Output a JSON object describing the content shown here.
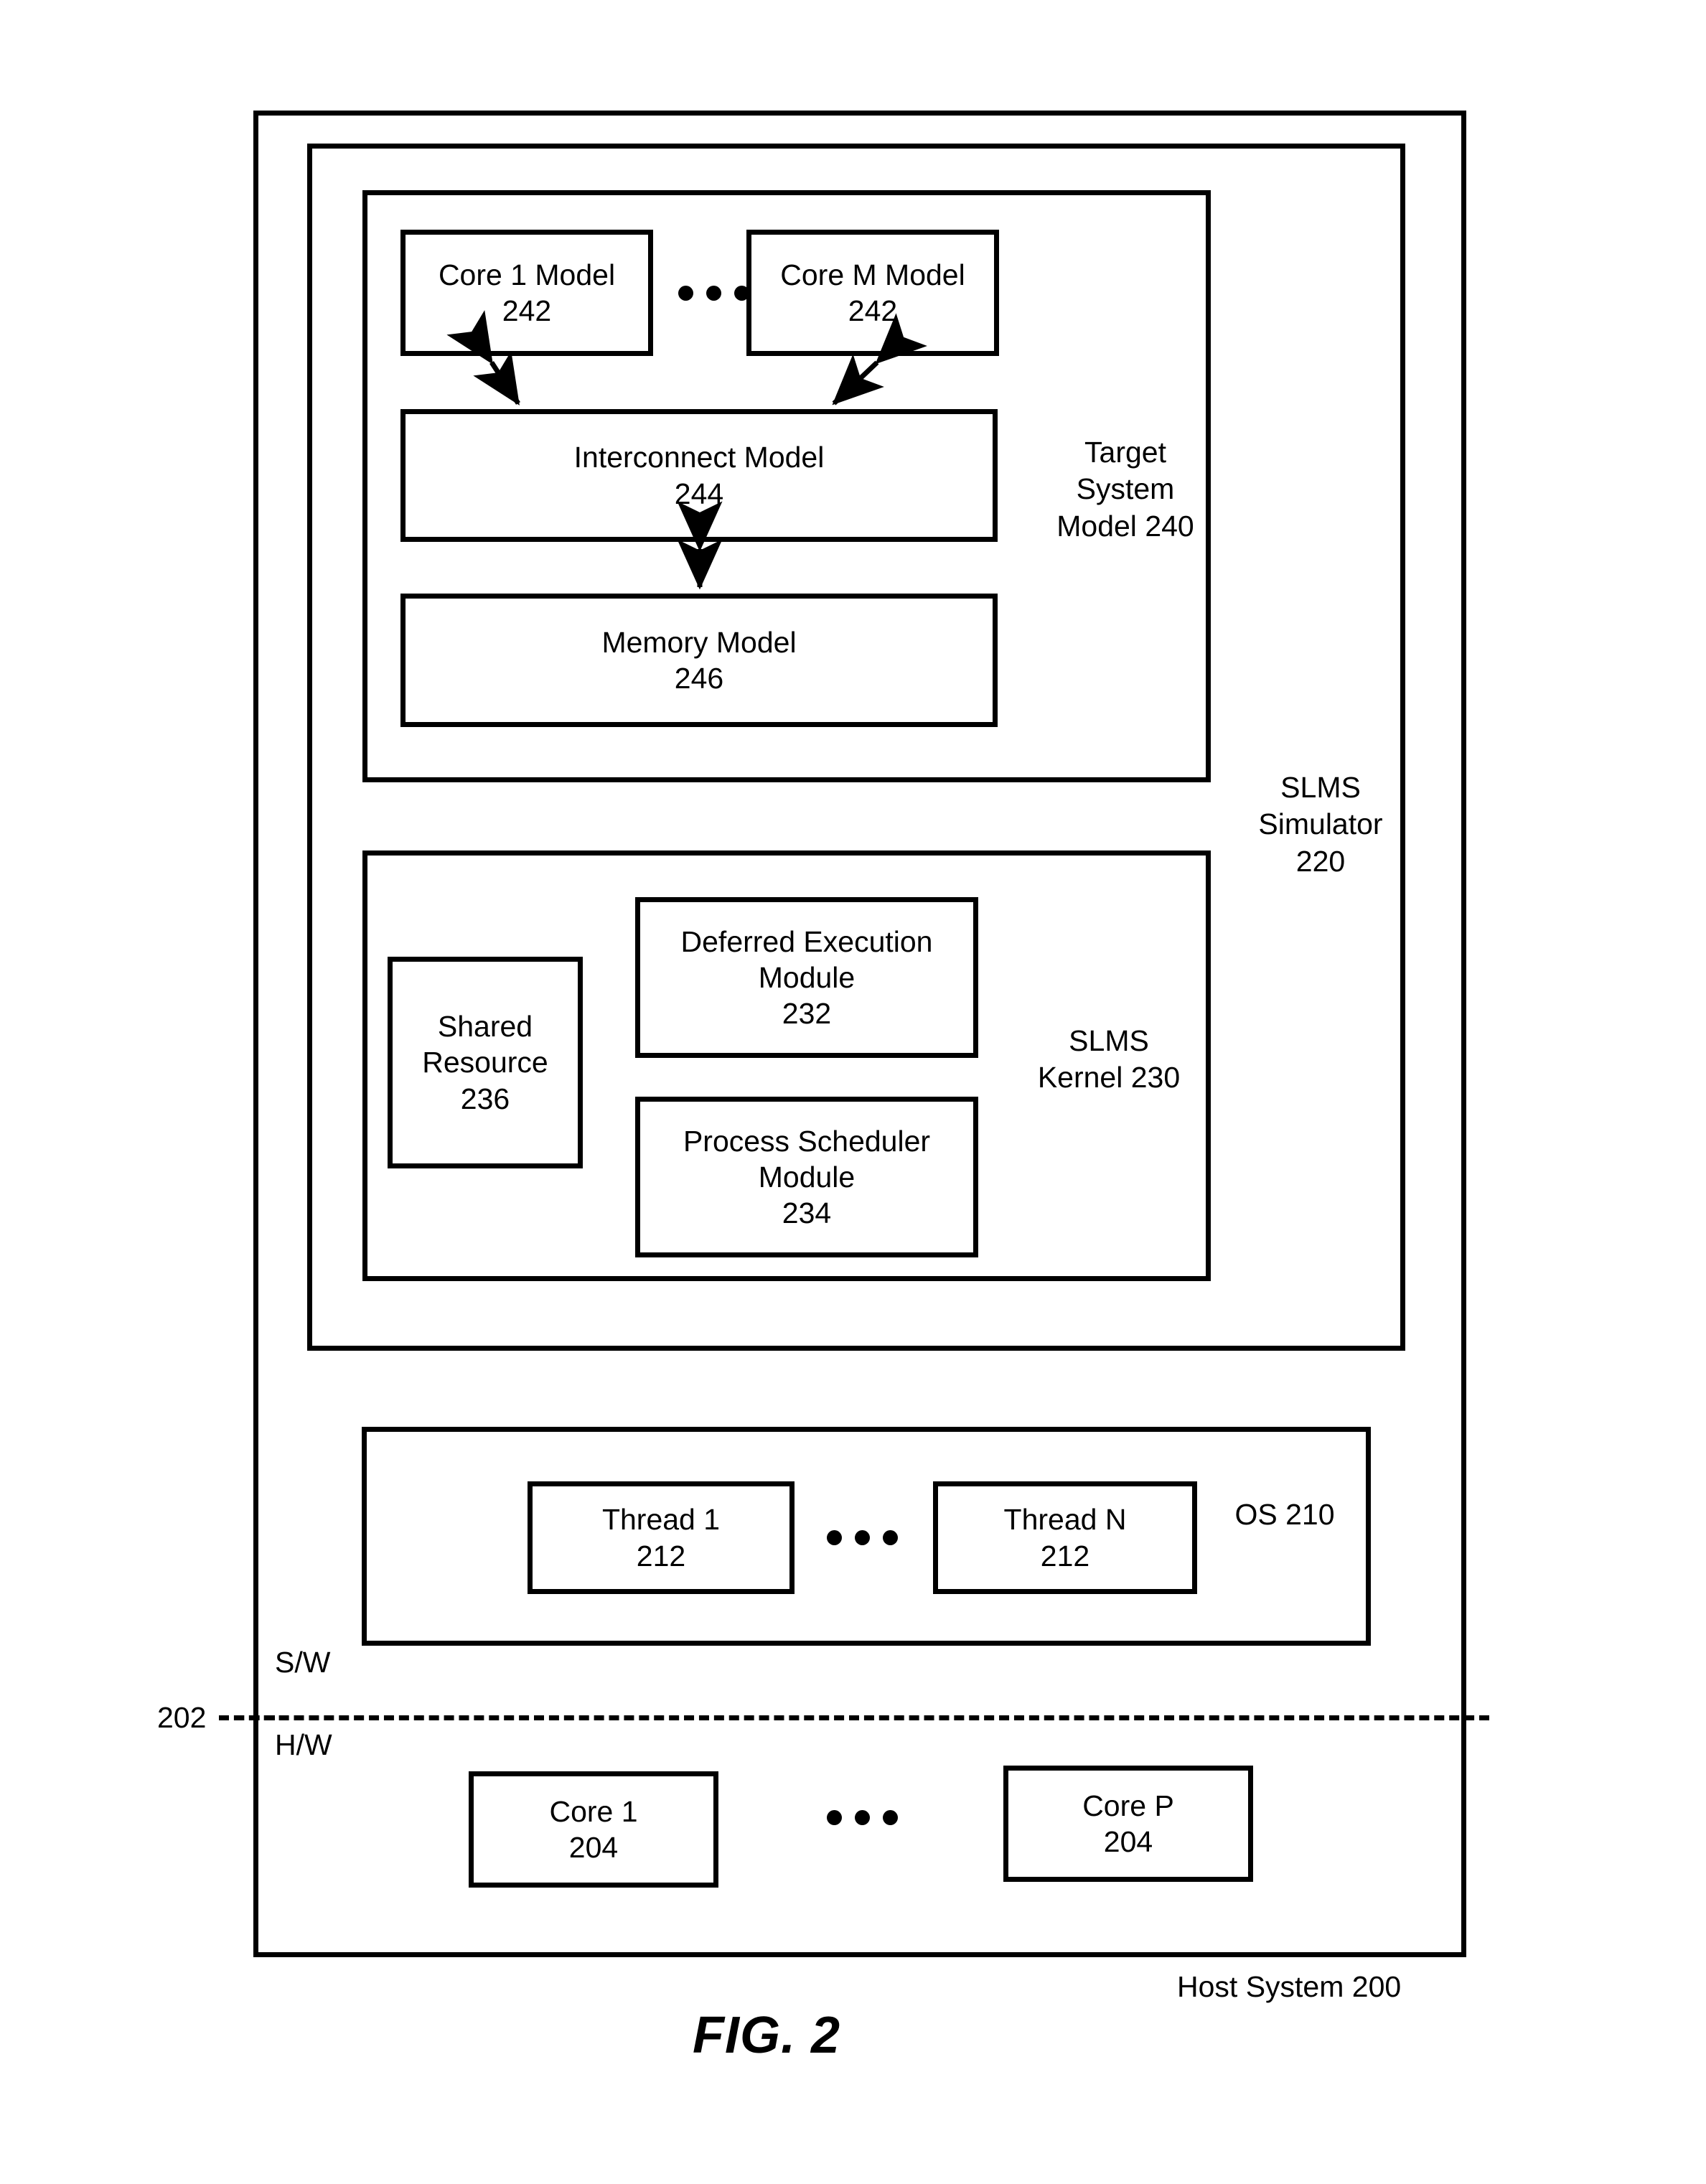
{
  "figure": {
    "caption": "FIG. 2",
    "host_system_label": "Host System 200",
    "boundary_ref": "202",
    "sw_label": "S/W",
    "hw_label": "H/W"
  },
  "simulator": {
    "label_line1": "SLMS",
    "label_line2": "Simulator",
    "label_line3": "220"
  },
  "target_system_model": {
    "label_line1": "Target",
    "label_line2": "System",
    "label_line3": "Model",
    "label_line4": "240",
    "core_models": [
      {
        "title": "Core 1 Model",
        "ref": "242"
      },
      {
        "title": "Core M Model",
        "ref": "242"
      }
    ],
    "interconnect": {
      "title": "Interconnect Model",
      "ref": "244"
    },
    "memory": {
      "title": "Memory Model",
      "ref": "246"
    }
  },
  "slms_kernel": {
    "label_line1": "SLMS",
    "label_line2": "Kernel",
    "label_line3": "230",
    "shared_resource": {
      "title_line1": "Shared",
      "title_line2": "Resource",
      "ref": "236"
    },
    "modules": [
      {
        "title_line1": "Deferred Execution",
        "title_line2": "Module",
        "ref": "232"
      },
      {
        "title_line1": "Process Scheduler",
        "title_line2": "Module",
        "ref": "234"
      }
    ]
  },
  "os": {
    "label_line1": "OS",
    "label_line2": "210",
    "threads": [
      {
        "title": "Thread 1",
        "ref": "212"
      },
      {
        "title": "Thread N",
        "ref": "212"
      }
    ]
  },
  "hardware": {
    "cores": [
      {
        "title": "Core 1",
        "ref": "204"
      },
      {
        "title": "Core P",
        "ref": "204"
      }
    ]
  }
}
